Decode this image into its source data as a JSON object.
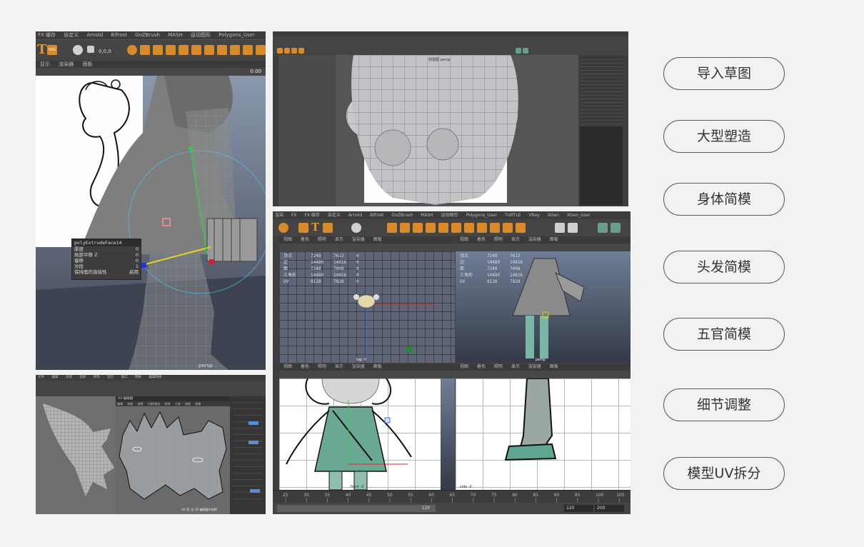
{
  "labels": [
    "导入草图",
    "大型塑造",
    "身体简模",
    "头发简模",
    "五官简模",
    "细节调整",
    "模型UV拆分"
  ],
  "panel1": {
    "menu": [
      "FX 缓存",
      "自定义",
      "Arnold",
      "Bifrost",
      "GoZBrush",
      "MASH",
      "运动图形",
      "Polygons_User"
    ],
    "panel_menu": [
      "显示",
      "渲染器",
      "面板"
    ],
    "coord": "0,0,0",
    "value": "0.00",
    "viewport_label": "persp",
    "extrude": {
      "title": "polyExtrudeFace14",
      "rows": [
        {
          "label": "厚度",
          "value": "0"
        },
        {
          "label": "局部平移 Z",
          "value": "0"
        },
        {
          "label": "偏移",
          "value": "0"
        },
        {
          "label": "分段",
          "value": "1"
        },
        {
          "label": "保持面的连接性",
          "value": "启用"
        }
      ]
    }
  },
  "panel2": {
    "view_label": "前视图 persp"
  },
  "panel3": {
    "menu": [
      "渲染",
      "FX",
      "FX 缓存",
      "自定义",
      "Arnold",
      "Bifrost",
      "GoZBrush",
      "MASH",
      "运动图形",
      "Polygons_User",
      "TURTLE",
      "VRay",
      "XGen",
      "XGen_User"
    ],
    "view_menu": [
      "视图",
      "着色",
      "照明",
      "显示",
      "渲染器",
      "面板"
    ],
    "stats_labels": [
      "顶点",
      "边",
      "面",
      "三角形",
      "UV"
    ],
    "stats_tl": [
      [
        "7248",
        "7612",
        "0"
      ],
      [
        "14480",
        "14816",
        "0"
      ],
      [
        "7240",
        "7008",
        "0"
      ],
      [
        "14480",
        "14816",
        "0"
      ],
      [
        "8138",
        "7828",
        "0"
      ]
    ],
    "stats_tr": [
      [
        "7248",
        "7612"
      ],
      [
        "14480",
        "14816"
      ],
      [
        "7240",
        "7008"
      ],
      [
        "14480",
        "14816"
      ],
      [
        "8138",
        "7828"
      ]
    ],
    "cam_labels": [
      "top -Y",
      "persp",
      "front -Z",
      "side -X"
    ],
    "timeline_ticks": [
      "25",
      "30",
      "35",
      "40",
      "45",
      "50",
      "55",
      "60",
      "65",
      "70",
      "75",
      "80",
      "85",
      "90",
      "95",
      "100",
      "105"
    ],
    "range_start": "120",
    "range_end": "120",
    "range_max": "200"
  },
  "panel4": {
    "menu": [
      "文件",
      "编辑",
      "创建",
      "选择",
      "修改",
      "显示",
      "窗口",
      "网格",
      "编辑网格"
    ],
    "uv_title": "UV 编辑器",
    "uv_menu": [
      "编辑",
      "创建",
      "选择",
      "切割/缝合",
      "修改",
      "工具",
      "视图",
      "图像"
    ],
    "bottom_text": "UV 壳: 在 UV 编辑器中选择"
  }
}
